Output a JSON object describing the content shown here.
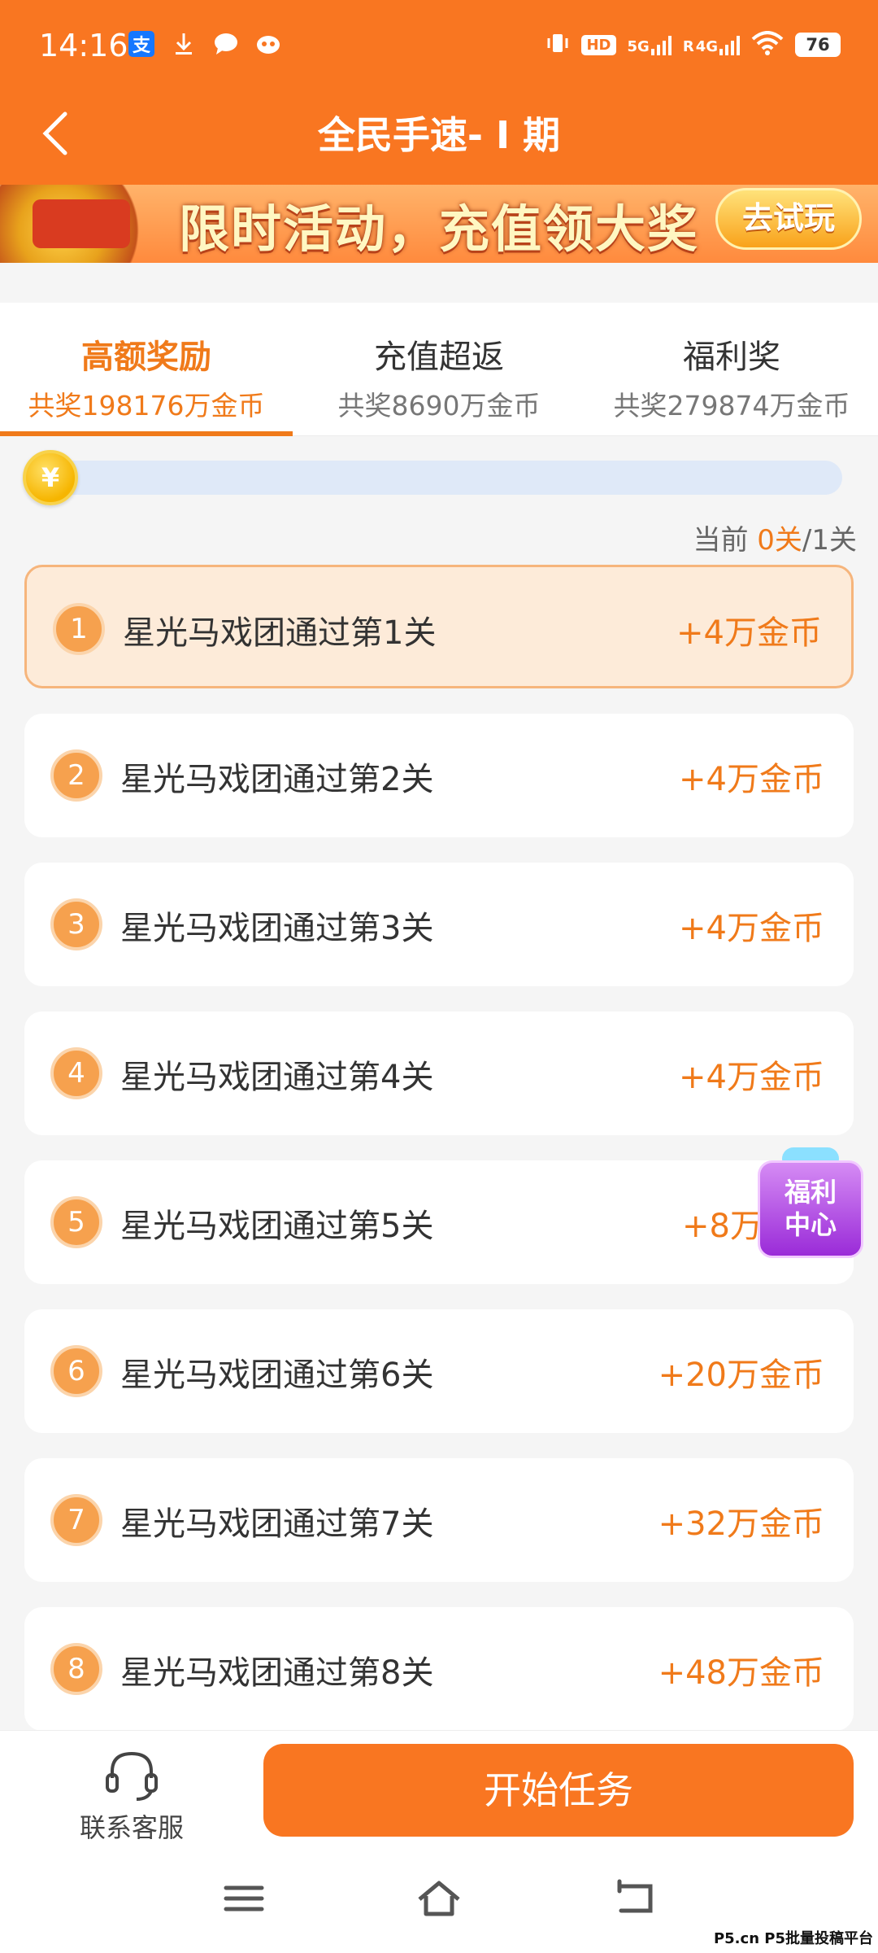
{
  "status_bar": {
    "time": "14:16",
    "network_5g": "5G",
    "network_4g": "4G",
    "hd_label": "HD",
    "roaming": "R",
    "battery": "76"
  },
  "header": {
    "title": "全民手速- Ⅰ 期",
    "bg_color": "#f97621"
  },
  "banner": {
    "text": "限时活动，充值领大奖",
    "button_label": "去试玩"
  },
  "tabs": [
    {
      "title": "高额奖励",
      "subtitle": "共奖198176万金币",
      "active": true
    },
    {
      "title": "充值超返",
      "subtitle": "共奖8690万金币",
      "active": false
    },
    {
      "title": "福利奖",
      "subtitle": "共奖279874万金币",
      "active": false
    }
  ],
  "progress": {
    "coin_symbol": "¥",
    "prefix": "当前 ",
    "current": "0关",
    "total": "/1关",
    "fraction": 0
  },
  "tasks": [
    {
      "num": "1",
      "label": "星光马戏团通过第1关",
      "reward": "+4万金币"
    },
    {
      "num": "2",
      "label": "星光马戏团通过第2关",
      "reward": "+4万金币"
    },
    {
      "num": "3",
      "label": "星光马戏团通过第3关",
      "reward": "+4万金币"
    },
    {
      "num": "4",
      "label": "星光马戏团通过第4关",
      "reward": "+4万金币"
    },
    {
      "num": "5",
      "label": "星光马戏团通过第5关",
      "reward": "+8万"
    },
    {
      "num": "6",
      "label": "星光马戏团通过第6关",
      "reward": "+20万金币"
    },
    {
      "num": "7",
      "label": "星光马戏团通过第7关",
      "reward": "+32万金币"
    },
    {
      "num": "8",
      "label": "星光马戏团通过第8关",
      "reward": "+48万金币"
    }
  ],
  "welfare_badge": {
    "line1": "福利",
    "line2": "中心"
  },
  "bottom": {
    "service_label": "联系客服",
    "start_label": "开始任务"
  },
  "watermark": "P5.cn P5批量投稿平台",
  "colors": {
    "accent": "#f07a1a",
    "primary": "#f97621"
  }
}
